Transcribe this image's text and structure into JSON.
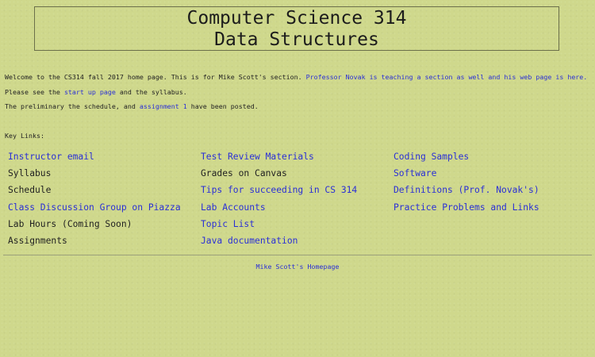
{
  "header": {
    "title_line1": "Computer Science 314",
    "title_line2": "Data Structures"
  },
  "intro": {
    "line1_text": "Welcome to the CS314 fall 2017 home page. This is for Mike Scott's section. ",
    "line1_link": "Professor Novak is teaching a section as well and his web page is here.",
    "line2_prefix": "Please see the ",
    "line2_link": "start up page",
    "line2_suffix": " and the syllabus.",
    "line3_prefix": "The preliminary the schedule, and ",
    "line3_link": "assignment 1",
    "line3_suffix": " have been posted."
  },
  "key_links_label": "Key Links:",
  "columns": [
    [
      {
        "label": "Instructor email",
        "is_link": true
      },
      {
        "label": "Syllabus",
        "is_link": false
      },
      {
        "label": "Schedule",
        "is_link": false
      },
      {
        "label": "Class Discussion Group on Piazza",
        "is_link": true
      },
      {
        "label": "Lab Hours (Coming Soon)",
        "is_link": false
      },
      {
        "label": "Assignments",
        "is_link": false
      }
    ],
    [
      {
        "label": "Test Review Materials",
        "is_link": true
      },
      {
        "label": "Grades on Canvas",
        "is_link": false
      },
      {
        "label": "Tips for succeeding in CS 314",
        "is_link": true
      },
      {
        "label": "Lab Accounts",
        "is_link": true
      },
      {
        "label": "Topic List",
        "is_link": true
      },
      {
        "label": "Java documentation",
        "is_link": true
      }
    ],
    [
      {
        "label": "Coding Samples",
        "is_link": true
      },
      {
        "label": "Software",
        "is_link": true
      },
      {
        "label": "Definitions (Prof. Novak's)",
        "is_link": true
      },
      {
        "label": "Practice Problems and Links",
        "is_link": true
      }
    ]
  ],
  "footer": {
    "link": "Mike Scott's Homepage"
  },
  "colors": {
    "background": "#cfd88c",
    "link": "#2a2fd6",
    "text": "#222222"
  }
}
